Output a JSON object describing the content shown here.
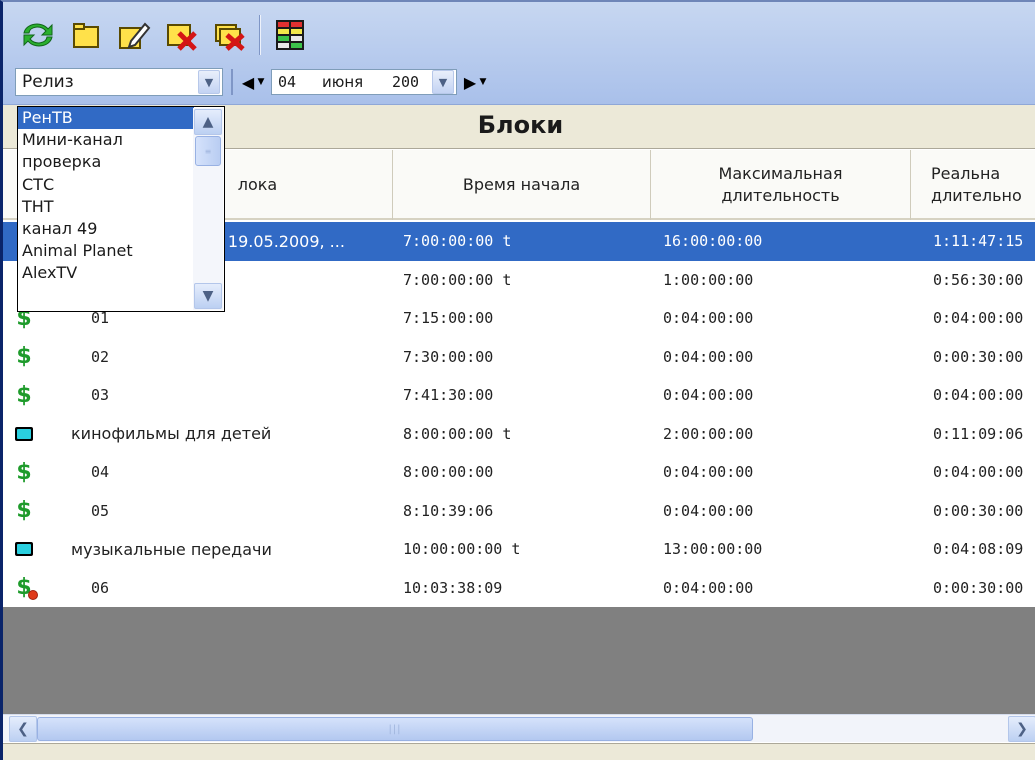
{
  "toolbar": {
    "buttons": [
      "refresh-icon",
      "new-folder-icon",
      "edit-icon",
      "delete-block-icon",
      "delete-all-icon",
      "schedule-grid-icon"
    ]
  },
  "filter": {
    "release_value": "Релиз",
    "date_day": "04",
    "date_month": "июня",
    "date_year": "200"
  },
  "channel_list": {
    "items": [
      "РенТВ",
      "Мини-канал",
      "проверка",
      "СТС",
      "ТНТ",
      "канал 49",
      "Animal Planet",
      "AlexTV"
    ],
    "selected_index": 0
  },
  "blocks": {
    "title": "Блоки",
    "columns": [
      "лока",
      "Время начала",
      "Максимальная длительность",
      "Реальна длительно"
    ],
    "rows": [
      {
        "name": "а 19.05.2009, ...",
        "start": "7:00:00:00 t",
        "max": "16:00:00:00",
        "real": "1:11:47:15",
        "icon": "none",
        "level": 0,
        "selected": true
      },
      {
        "name": "",
        "start": "7:00:00:00 t",
        "max": "1:00:00:00",
        "real": "0:56:30:00",
        "icon": "none",
        "level": 0,
        "selected": false
      },
      {
        "name": "01",
        "start": "7:15:00:00",
        "max": "0:04:00:00",
        "real": "0:04:00:00",
        "icon": "dollar-icon",
        "level": 2,
        "selected": false
      },
      {
        "name": "02",
        "start": "7:30:00:00",
        "max": "0:04:00:00",
        "real": "0:00:30:00",
        "icon": "dollar-icon",
        "level": 2,
        "selected": false
      },
      {
        "name": "03",
        "start": "7:41:30:00",
        "max": "0:04:00:00",
        "real": "0:04:00:00",
        "icon": "dollar-icon",
        "level": 2,
        "selected": false
      },
      {
        "name": "кинофильмы для детей",
        "start": "8:00:00:00 t",
        "max": "2:00:00:00",
        "real": "0:11:09:06",
        "icon": "tv-block-icon",
        "level": 1,
        "selected": false
      },
      {
        "name": "04",
        "start": "8:00:00:00",
        "max": "0:04:00:00",
        "real": "0:04:00:00",
        "icon": "dollar-icon",
        "level": 2,
        "selected": false
      },
      {
        "name": "05",
        "start": "8:10:39:06",
        "max": "0:04:00:00",
        "real": "0:00:30:00",
        "icon": "dollar-icon",
        "level": 2,
        "selected": false
      },
      {
        "name": "музыкальные передачи",
        "start": "10:00:00:00 t",
        "max": "13:00:00:00",
        "real": "0:04:08:09",
        "icon": "tv-block-icon",
        "level": 1,
        "selected": false
      },
      {
        "name": "06",
        "start": "10:03:38:09",
        "max": "0:04:00:00",
        "real": "0:00:30:00",
        "icon": "dollar-error-icon",
        "level": 2,
        "selected": false
      }
    ]
  },
  "colors": {
    "selection": "#316ac5",
    "dollar": "#1e9b2b",
    "toolbar_bg": "#b8ccee"
  }
}
